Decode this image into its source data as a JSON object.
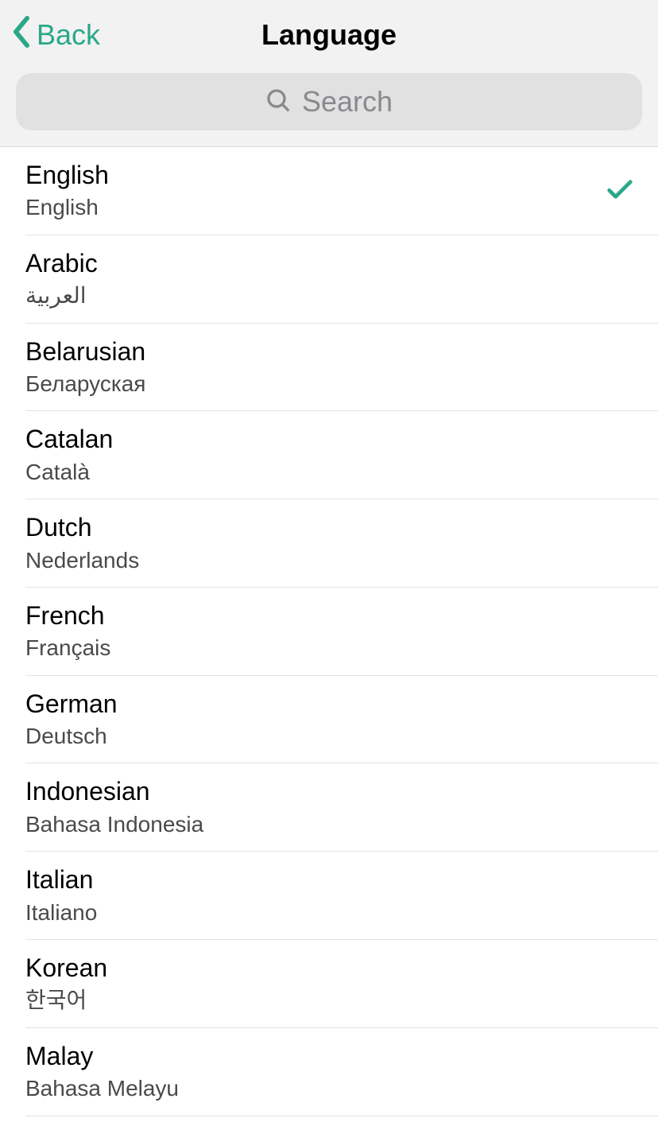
{
  "header": {
    "back_label": "Back",
    "title": "Language",
    "search_placeholder": "Search"
  },
  "accent_color": "#2aa888",
  "languages": [
    {
      "name": "English",
      "native": "English",
      "selected": true
    },
    {
      "name": "Arabic",
      "native": "العربية",
      "selected": false
    },
    {
      "name": "Belarusian",
      "native": "Беларуская",
      "selected": false
    },
    {
      "name": "Catalan",
      "native": "Català",
      "selected": false
    },
    {
      "name": "Dutch",
      "native": "Nederlands",
      "selected": false
    },
    {
      "name": "French",
      "native": "Français",
      "selected": false
    },
    {
      "name": "German",
      "native": "Deutsch",
      "selected": false
    },
    {
      "name": "Indonesian",
      "native": "Bahasa Indonesia",
      "selected": false
    },
    {
      "name": "Italian",
      "native": "Italiano",
      "selected": false
    },
    {
      "name": "Korean",
      "native": "한국어",
      "selected": false
    },
    {
      "name": "Malay",
      "native": "Bahasa Melayu",
      "selected": false
    }
  ]
}
